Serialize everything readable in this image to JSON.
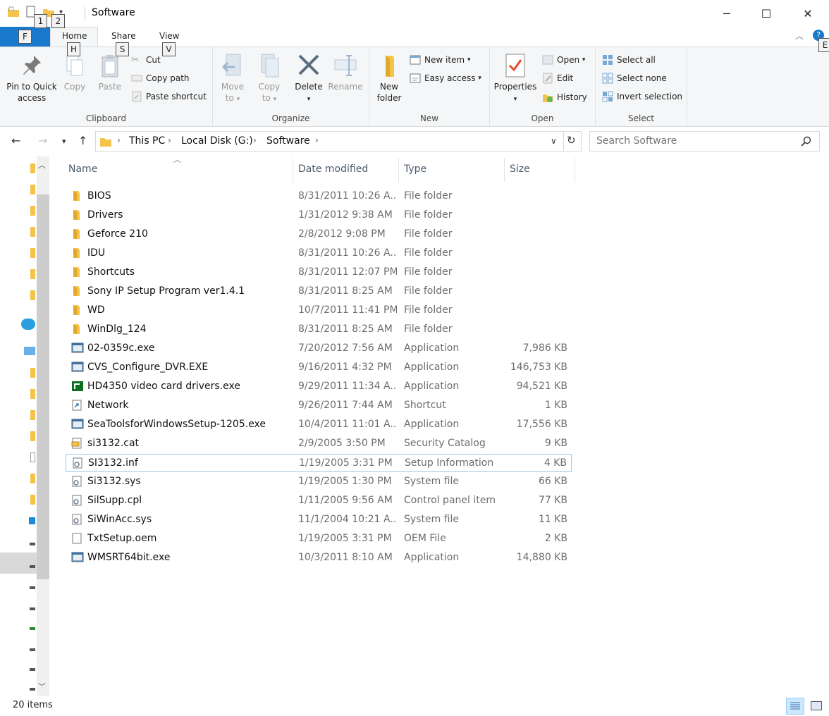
{
  "window": {
    "title": "Software",
    "minimize": "─",
    "maximize": "☐",
    "close": "✕"
  },
  "keytips": {
    "qa1": "1",
    "qa2": "2",
    "file": "F",
    "home": "H",
    "share": "S",
    "view": "V",
    "help": "E"
  },
  "tabs": {
    "home": "Home",
    "share": "Share",
    "view": "View"
  },
  "ribbon": {
    "clipboard": {
      "label": "Clipboard",
      "pin": "Pin to Quick access",
      "copy": "Copy",
      "paste": "Paste",
      "cut": "Cut",
      "copy_path": "Copy path",
      "paste_shortcut": "Paste shortcut"
    },
    "organize": {
      "label": "Organize",
      "move_to": "Move to",
      "copy_to": "Copy to",
      "delete": "Delete",
      "rename": "Rename"
    },
    "new": {
      "label": "New",
      "new_folder": "New folder",
      "new_item": "New item",
      "easy_access": "Easy access"
    },
    "open": {
      "label": "Open",
      "properties": "Properties",
      "open": "Open",
      "edit": "Edit",
      "history": "History"
    },
    "select": {
      "label": "Select",
      "select_all": "Select all",
      "select_none": "Select none",
      "invert": "Invert selection"
    }
  },
  "address": {
    "crumbs": [
      "This PC",
      "Local Disk (G:)",
      "Software"
    ]
  },
  "search": {
    "placeholder": "Search Software"
  },
  "columns": {
    "name": "Name",
    "date": "Date modified",
    "type": "Type",
    "size": "Size"
  },
  "files": [
    {
      "name": "BIOS",
      "date": "8/31/2011 10:26 A...",
      "type": "File folder",
      "size": "",
      "icon": "folder"
    },
    {
      "name": "Drivers",
      "date": "1/31/2012 9:38 AM",
      "type": "File folder",
      "size": "",
      "icon": "folder"
    },
    {
      "name": "Geforce 210",
      "date": "2/8/2012 9:08 PM",
      "type": "File folder",
      "size": "",
      "icon": "folder"
    },
    {
      "name": "IDU",
      "date": "8/31/2011 10:26 A...",
      "type": "File folder",
      "size": "",
      "icon": "folder"
    },
    {
      "name": "Shortcuts",
      "date": "8/31/2011 12:07 PM",
      "type": "File folder",
      "size": "",
      "icon": "folder"
    },
    {
      "name": "Sony IP Setup Program ver1.4.1",
      "date": "8/31/2011 8:25 AM",
      "type": "File folder",
      "size": "",
      "icon": "folder"
    },
    {
      "name": "WD",
      "date": "10/7/2011 11:41 PM",
      "type": "File folder",
      "size": "",
      "icon": "folder"
    },
    {
      "name": "WinDlg_124",
      "date": "8/31/2011 8:25 AM",
      "type": "File folder",
      "size": "",
      "icon": "folder"
    },
    {
      "name": "02-0359c.exe",
      "date": "7/20/2012 7:56 AM",
      "type": "Application",
      "size": "7,986 KB",
      "icon": "app"
    },
    {
      "name": "CVS_Configure_DVR.EXE",
      "date": "9/16/2011 4:32 PM",
      "type": "Application",
      "size": "146,753 KB",
      "icon": "app"
    },
    {
      "name": "HD4350 video card drivers.exe",
      "date": "9/29/2011 11:34 A...",
      "type": "Application",
      "size": "94,521 KB",
      "icon": "amd"
    },
    {
      "name": "Network",
      "date": "9/26/2011 7:44 AM",
      "type": "Shortcut",
      "size": "1 KB",
      "icon": "shortcut"
    },
    {
      "name": "SeaToolsforWindowsSetup-1205.exe",
      "date": "10/4/2011 11:01 A...",
      "type": "Application",
      "size": "17,556 KB",
      "icon": "app"
    },
    {
      "name": "si3132.cat",
      "date": "2/9/2005 3:50 PM",
      "type": "Security Catalog",
      "size": "9 KB",
      "icon": "cat"
    },
    {
      "name": "SI3132.inf",
      "date": "1/19/2005 3:31 PM",
      "type": "Setup Information",
      "size": "4 KB",
      "icon": "gear-file"
    },
    {
      "name": "Si3132.sys",
      "date": "1/19/2005 1:30 PM",
      "type": "System file",
      "size": "66 KB",
      "icon": "gear-file"
    },
    {
      "name": "SilSupp.cpl",
      "date": "1/11/2005 9:56 AM",
      "type": "Control panel item",
      "size": "77 KB",
      "icon": "gear-file"
    },
    {
      "name": "SiWinAcc.sys",
      "date": "11/1/2004 10:21 A...",
      "type": "System file",
      "size": "11 KB",
      "icon": "gear-file"
    },
    {
      "name": "TxtSetup.oem",
      "date": "1/19/2005 3:31 PM",
      "type": "OEM File",
      "size": "2 KB",
      "icon": "blank-file"
    },
    {
      "name": "WMSRT64bit.exe",
      "date": "10/3/2011 8:10 AM",
      "type": "Application",
      "size": "14,880 KB",
      "icon": "app"
    }
  ],
  "selected_index": 14,
  "status": {
    "count": "20 items"
  },
  "colors": {
    "file_tab": "#1979ca",
    "folder": "#f3c34a",
    "selection_border": "#99c9ef",
    "header_text": "#4c5a6d"
  }
}
